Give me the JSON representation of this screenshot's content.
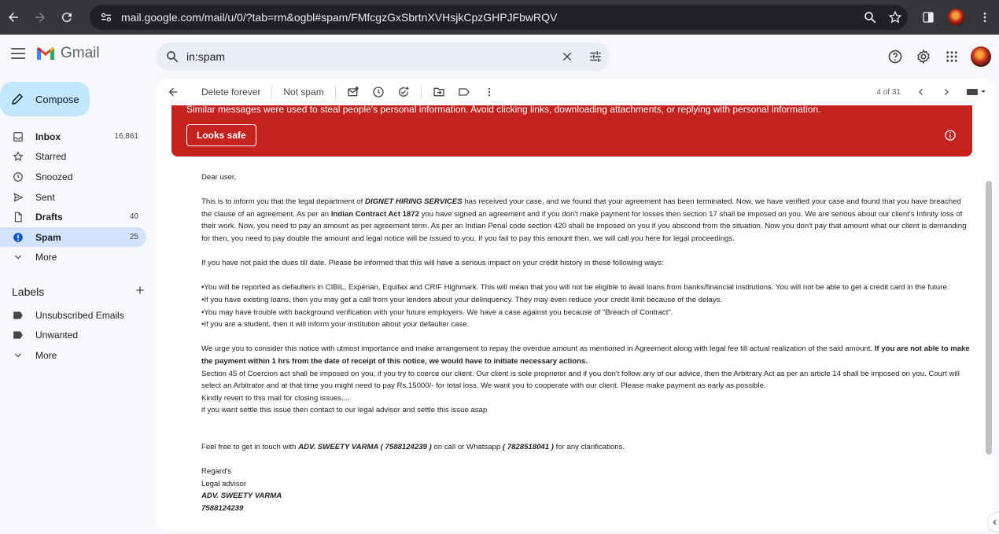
{
  "browser": {
    "url": "mail.google.com/mail/u/0/?tab=rm&ogbl#spam/FMfcgzGxSbrtnXVHsjkCpzGHPJFbwRQV"
  },
  "header": {
    "app_name": "Gmail",
    "search_value": "in:spam"
  },
  "sidebar": {
    "compose_label": "Compose",
    "items": [
      {
        "label": "Inbox",
        "count": "16,861",
        "icon": "inbox-icon"
      },
      {
        "label": "Starred",
        "count": "",
        "icon": "star-icon"
      },
      {
        "label": "Snoozed",
        "count": "",
        "icon": "clock-icon"
      },
      {
        "label": "Sent",
        "count": "",
        "icon": "send-icon"
      },
      {
        "label": "Drafts",
        "count": "40",
        "icon": "draft-icon"
      },
      {
        "label": "Spam",
        "count": "25",
        "icon": "spam-icon"
      },
      {
        "label": "More",
        "count": "",
        "icon": "chevron-down-icon"
      }
    ],
    "labels_title": "Labels",
    "labels": [
      {
        "label": "Unsubscribed Emails",
        "icon": "label-icon"
      },
      {
        "label": "Unwanted",
        "icon": "label-icon"
      },
      {
        "label": "More",
        "icon": "chevron-down-icon"
      }
    ]
  },
  "toolbar": {
    "delete_forever": "Delete forever",
    "not_spam": "Not spam",
    "page_count": "4 of 31"
  },
  "banner": {
    "message": "Similar messages were used to steal people's personal information. Avoid clicking links, downloading attachments, or replying with personal information.",
    "looks_safe": "Looks safe",
    "color": "#c5221f"
  },
  "email": {
    "greeting": "Dear user,",
    "p1_a": "This is to inform you that the legal department of ",
    "p1_company": "DIGNET HIRING SERVICES",
    "p1_b": " has received your case, and we found that your agreement has been terminated. Now, we have verified your case and found that you have breached the clause of an agreement. As per an ",
    "p1_act": "Indian Contract Act 1872",
    "p1_c": " you have signed an agreement and if you don't make payment for losses then section 17 shall be imposed on you. We are serious about our client's Infinity loss of their work. Now, you need to pay an amount as per agreement term. As per an Indian Penal code section 420 shall be imposed on you if you abscond from the situation. Now you don't pay that amount what our client is demanding for then, you need to pay double the amount and legal notice will be issued to you. If you fail to pay this amount then, we will call you here for legal proceedings.",
    "p2": "If you have not paid the dues till date. Please be informed that this will have a serious impact on your credit history in these following ways:",
    "bullets": [
      "•You will be reported as defaulters in CIBIL, Experian, Equifax and CRIF Highmark. This will mean that you will not be eligible to avail loans from banks/financial institutions. You will not be able to get a credit card in the future.",
      "•If you have existing loans, then you may get a call from your lenders about your delinquency. They may even reduce your credit limit because of the delays.",
      "•You may have trouble with background verification with your future employers. We have a case against you because of \"Breach of Contract\".",
      "•If you are a student, then it will inform your institution about your defaulter case."
    ],
    "p3_a": "We urge you to consider this notice with utmost importance and make arrangement to repay the overdue amount as mentioned in Agreement along with legal fee till actual realization of the said amount. ",
    "p3_bold": "If you are not able to make the payment within 1 hrs from the date of receipt of this notice, we would have to initiate necessary actions.",
    "p4": "Section 45 of Coercion act shall be imposed on you, if you try to coerce our client. Our client is sole proprietor and if you don't follow any of our advice, then the Arbitrary Act as per an article 14 shall be imposed on you. Court will select an Arbitrator and at that time you might need to pay Rs.15000/- for total loss. We want you to cooperate with our client. Please make payment as early as possible.",
    "p5": "Kindly revert to this mail for closing issues....",
    "p6": "if you want settle this issue then contact to our legal advisor and settle this issue asap",
    "p7_a": "Feel free to get in touch with ",
    "p7_name": "ADV. SWEETY VARMA ( 7588124239  )",
    "p7_b": " on call or Whatsapp ",
    "p7_wa": "( 7828518041 )",
    "p7_c": " for any clarifications.",
    "sign_regards": "Regard's",
    "sign_role": "Legal advisor",
    "sign_name": "ADV. SWEETY VARMA",
    "sign_phone": "7588124239"
  }
}
